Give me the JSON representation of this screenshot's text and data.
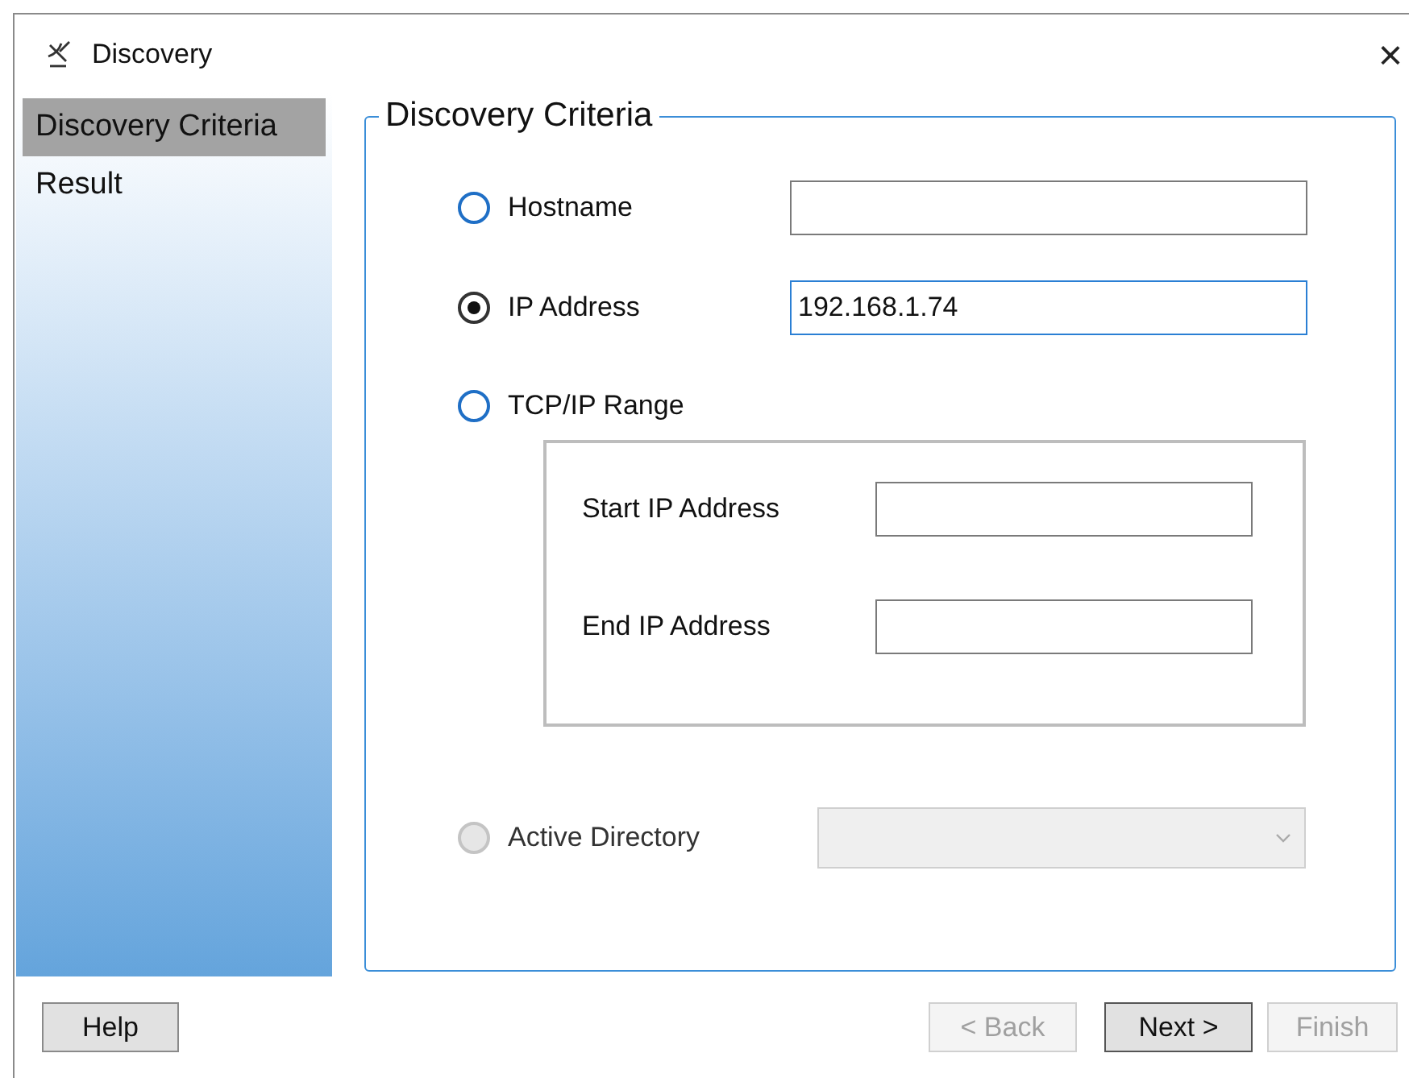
{
  "window": {
    "title": "Discovery",
    "close": "×"
  },
  "sidebar": {
    "items": [
      {
        "label": "Discovery Criteria",
        "selected": true
      },
      {
        "label": "Result",
        "selected": false
      }
    ]
  },
  "criteria": {
    "title": "Discovery Criteria",
    "options": [
      {
        "kind": "text",
        "label": "Hostname",
        "selected": false,
        "disabled": false,
        "focused": false
      },
      {
        "kind": "text",
        "label": "IP Address",
        "selected": true,
        "disabled": false,
        "focused": true,
        "value": "192.168.1.74"
      },
      {
        "kind": "range",
        "label": "TCP/IP Range",
        "selected": false,
        "disabled": false,
        "fields": [
          {
            "label": "Start IP Address"
          },
          {
            "label": "End IP Address"
          }
        ]
      },
      {
        "kind": "dropdown",
        "label": "Active Directory",
        "selected": false,
        "disabled": true
      }
    ]
  },
  "buttons": [
    {
      "label": "Help",
      "disabled": false,
      "default": false
    },
    {
      "label": "< Back",
      "disabled": true,
      "default": false
    },
    {
      "label": "Next >",
      "disabled": false,
      "default": true
    },
    {
      "label": "Finish",
      "disabled": true,
      "default": false
    }
  ]
}
